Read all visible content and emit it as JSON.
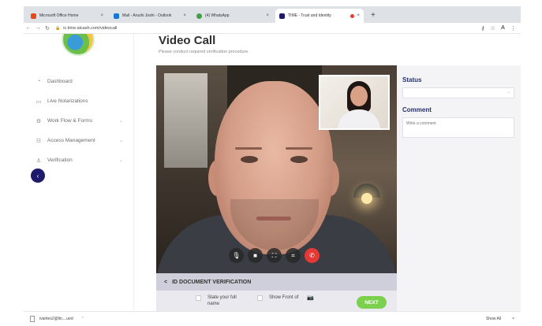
{
  "browser": {
    "tabs": [
      {
        "title": "Microsoft Office Home",
        "favicon_color": "#e64a19"
      },
      {
        "title": "Mail - Arushi Joshi - Outlook",
        "favicon_color": "#1976d2"
      },
      {
        "title": "(4) WhatsApp",
        "favicon_color": "#43a047"
      },
      {
        "title": "TIME - Trust and Identity",
        "favicon_color": "#1e1a6e",
        "active": true
      }
    ],
    "new_tab": "+",
    "url": "ic.time.aicash.com/videocall",
    "icons": [
      "back-icon",
      "forward-icon",
      "reload-icon",
      "lock-icon",
      "key-icon",
      "star-icon",
      "profile-icon",
      "menu-icon"
    ]
  },
  "sidebar": {
    "items": [
      {
        "label": "Dashboard",
        "icon": "dashboard-icon",
        "has_chevron": false
      },
      {
        "label": "Live Notarizations",
        "icon": "notarization-icon",
        "has_chevron": false
      },
      {
        "label": "Work Flow & Forms",
        "icon": "workflow-icon",
        "has_chevron": true
      },
      {
        "label": "Access Management",
        "icon": "access-icon",
        "has_chevron": true
      },
      {
        "label": "Verification",
        "icon": "verification-icon",
        "has_chevron": true
      }
    ],
    "collapse_glyph": "‹",
    "accent": "#1e1a6e"
  },
  "page": {
    "title": "Video Call",
    "subtitle": "Please conduct required verification procedure"
  },
  "call": {
    "controls": [
      "microphone-icon",
      "camera-icon",
      "fullscreen-icon",
      "crop-icon",
      "end-call-icon"
    ]
  },
  "id_verification": {
    "header": "ID DOCUMENT VERIFICATION",
    "back_glyph": "<",
    "steps": [
      {
        "label": "State your full name"
      },
      {
        "label": "Show Front of"
      }
    ],
    "next_label": "NEXT",
    "next_color": "#7bd14d"
  },
  "panel": {
    "status_label": "Status",
    "comment_label": "Comment",
    "comment_placeholder": "Write a comment",
    "label_color": "#24306e"
  },
  "downloads": {
    "file": "ivarites2@lin....ued",
    "show_all": "Show All",
    "close": "×"
  }
}
